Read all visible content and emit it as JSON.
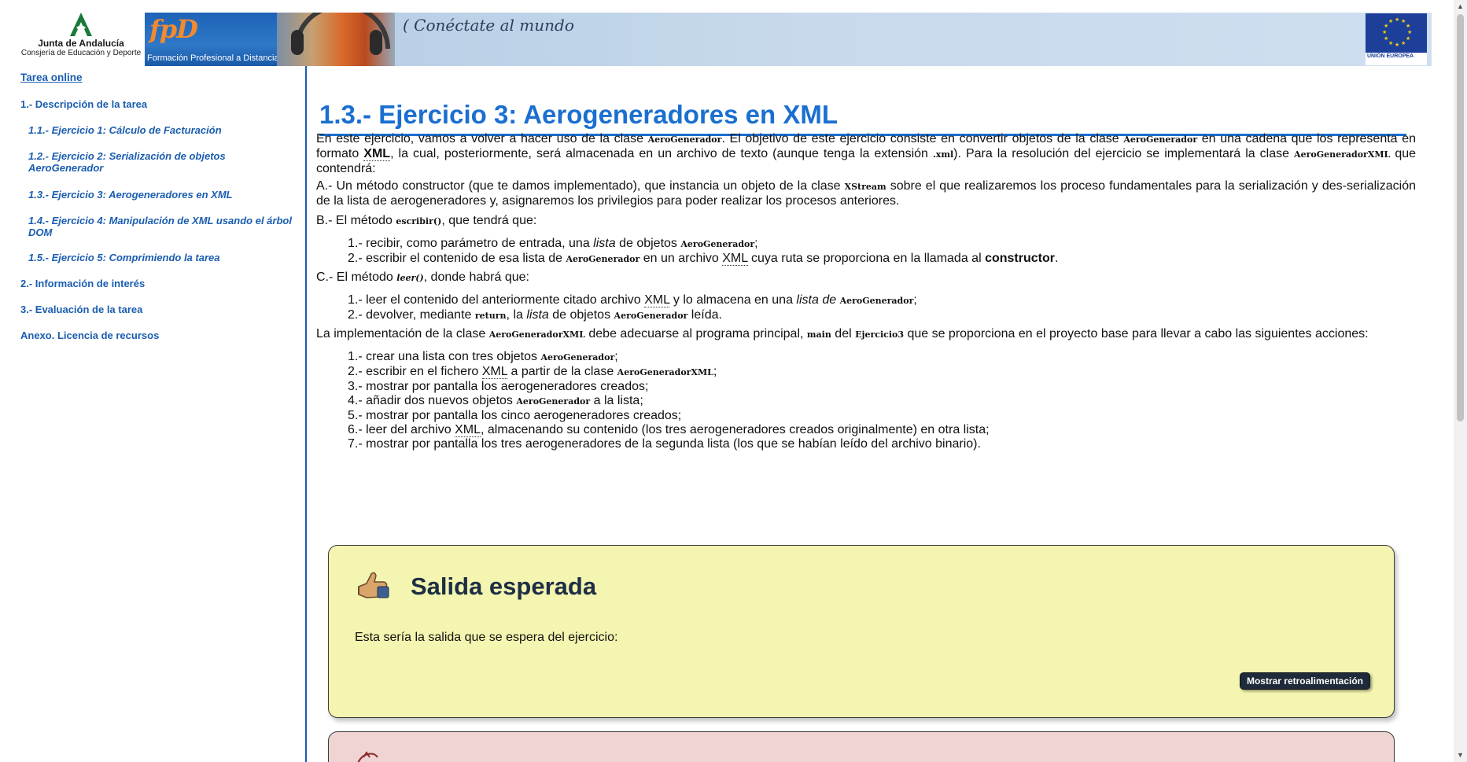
{
  "header": {
    "junta_name": "Junta de Andalucía",
    "junta_sub": "Consjería de Educación y Deporte",
    "fpd_logo": "fpD",
    "fpd_text": "Formación Profesional a Distancia",
    "tagline": "( Conéctate al mundo",
    "eu_caption": "UNIÓN EUROPEA"
  },
  "sidebar": {
    "tarea_online": "Tarea online",
    "items": [
      {
        "label": "1.- Descripción de la tarea"
      },
      {
        "label": "1.1.- Ejercicio 1: Cálculo de Facturación"
      },
      {
        "label": "1.2.- Ejercicio 2: Serialización de objetos AeroGenerador"
      },
      {
        "label": "1.3.- Ejercicio 3: Aerogeneradores en XML"
      },
      {
        "label": "1.4.- Ejercicio 4: Manipulación de XML usando el árbol DOM"
      },
      {
        "label": "1.5.- Ejercicio 5: Comprimiendo la tarea"
      },
      {
        "label": "2.- Información de interés"
      },
      {
        "label": "3.- Evaluación de la tarea"
      },
      {
        "label": "Anexo. Licencia de recursos"
      }
    ]
  },
  "main": {
    "title": "1.3.- Ejercicio 3: Aerogeneradores en XML",
    "intro": {
      "t1": "En este ejercicio, vamos a volver a hacer uso de la clase ",
      "c1": "AeroGenerador",
      "t2": ". El objetivo de este ejercicio consiste en convertir objetos de la clase ",
      "c2": "AeroGenerador",
      "t3": " en una cadena que los representa en formato ",
      "xml": "XML",
      "t4": ", la cual, posteriormente, será almacenada en un archivo de texto (aunque tenga la extensión ",
      "c3": ".xml",
      "t5": "). Para la resolución del ejercicio se implementará la clase ",
      "c4": "AeroGeneradorXML",
      "t6": " que contendrá:"
    },
    "part_a": {
      "t1": "A.- Un método constructor (que te damos implementado), que instancia un objeto de la clase ",
      "c1": "XStream",
      "t2": " sobre el que realizaremos los proceso fundamentales para la serialización y des-serialización de la lista de aerogeneradores y, asignaremos los privilegios para poder realizar los procesos anteriores."
    },
    "part_b": {
      "t1": "B.- El método ",
      "c1": "escribir()",
      "t2": ", que tendrá que:",
      "i1_a": "1.- recibir, como parámetro de entrada, una ",
      "i1_b": "lista",
      "i1_c": " de objetos ",
      "i1_d": "AeroGenerador",
      "i1_e": ";",
      "i2_a": "2.- escribir el contenido de esa lista de ",
      "i2_b": "AeroGenerador",
      "i2_c": " en un archivo ",
      "i2_d": "XML",
      "i2_e": " cuya ruta se proporciona en la llamada al ",
      "i2_f": "constructor",
      "i2_g": "."
    },
    "part_c": {
      "t1": "C.- El método ",
      "c1": "leer()",
      "t2": ", donde habrá que:",
      "i1_a": "1.- leer el contenido del anteriormente citado archivo ",
      "i1_b": "XML",
      "i1_c": " y lo almacena en una ",
      "i1_d": "lista de",
      "i1_e": " ",
      "i1_f": "AeroGenerador",
      "i1_g": ";",
      "i2_a": "2.- devolver, mediante ",
      "i2_b": "return",
      "i2_c": ", la ",
      "i2_d": "lista",
      "i2_e": " de objetos ",
      "i2_f": "AeroGenerador",
      "i2_g": " leída."
    },
    "impl": {
      "t1": "La implementación de la clase ",
      "c1": "AeroGeneradorXML",
      "t2": " debe adecuarse al programa principal, ",
      "c2": "main",
      "t3": " del ",
      "c3": "Ejercicio3",
      "t4": " que se proporciona en el proyecto base para llevar a cabo las siguientes acciones:"
    },
    "actions": {
      "a1_a": "1.- crear una lista con tres objetos ",
      "a1_b": "AeroGenerador",
      "a1_c": ";",
      "a2_a": "2.- escribir en el fichero ",
      "a2_b": "XML",
      "a2_c": " a partir de la clase ",
      "a2_d": "AeroGeneradorXML",
      "a2_e": ";",
      "a3": "3.- mostrar por pantalla los aerogeneradores creados;",
      "a4_a": "4.- añadir dos nuevos objetos ",
      "a4_b": "AeroGenerador",
      "a4_c": " a la lista;",
      "a5": "5.- mostrar por pantalla los cinco aerogeneradores creados;",
      "a6_a": "6.- leer del archivo ",
      "a6_b": "XML",
      "a6_c": ", almacenando su contenido (los tres aerogeneradores creados originalmente) en otra lista;",
      "a7": "7.- mostrar por pantalla los tres aerogeneradores de la segunda lista (los que se habían leído del archivo binario)."
    },
    "salida": {
      "title": "Salida esperada",
      "text": "Esta sería la salida que se espera del ejercicio:",
      "button": "Mostrar retroalimentación"
    }
  },
  "colors": {
    "link_blue": "#1a5db0",
    "title_blue": "#1a6fd0",
    "callout_yellow": "#f3f5b0",
    "callout_red": "#f0d3d3"
  },
  "icons": [
    "junta-logo-icon",
    "eu-flag-icon",
    "thumbs-up-icon",
    "hand-icon",
    "scroll-up-icon",
    "scroll-down-icon"
  ]
}
